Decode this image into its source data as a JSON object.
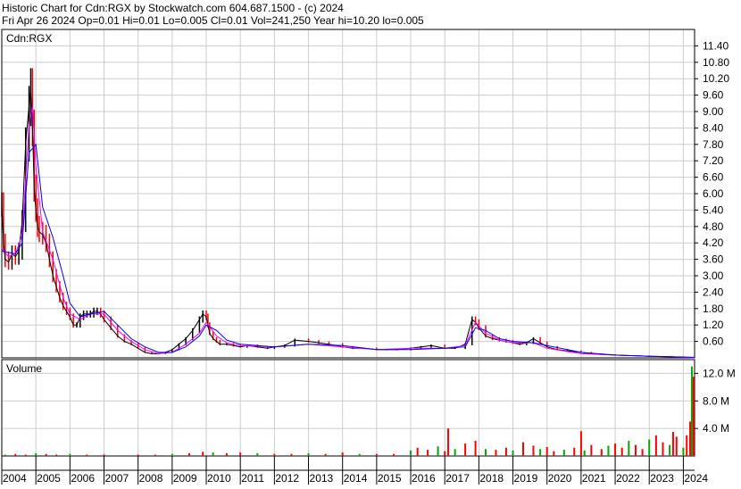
{
  "header": {
    "line1": "Historic Chart for Cdn:RGX by Stockwatch.com 604.687.1500 - (c) 2024",
    "line2": "Fri Apr 26 2024   Op=0.01  Hi=0.01  Lo=0.005  Cl=0.01  Vol=241,250  Year hi=10.20  lo=0.005"
  },
  "price_panel": {
    "symbol_label": "Cdn:RGX"
  },
  "volume_panel": {
    "label": "Volume"
  },
  "colors": {
    "background": "#ffffff",
    "grid": "#cccccc",
    "price_up": "#000000",
    "price_down": "#ff0000",
    "ma_short": "#ff00ff",
    "ma_long": "#0000ff",
    "volume_up": "#00aa00",
    "volume_down": "#ff0000"
  },
  "chart_data": [
    {
      "type": "line",
      "title": "Historic Chart for Cdn:RGX",
      "ylabel": "",
      "xlabel": "",
      "ylim": [
        0,
        12.0
      ],
      "yticks": [
        "11.40",
        "10.80",
        "10.20",
        "9.60",
        "9.00",
        "8.40",
        "7.80",
        "7.20",
        "6.60",
        "6.00",
        "5.40",
        "4.80",
        "4.20",
        "3.60",
        "3.00",
        "2.40",
        "1.80",
        "1.20",
        "0.60"
      ],
      "ytick_values": [
        11.4,
        10.8,
        10.2,
        9.6,
        9.0,
        8.4,
        7.8,
        7.2,
        6.6,
        6.0,
        5.4,
        4.8,
        4.2,
        3.6,
        3.0,
        2.4,
        1.8,
        1.2,
        0.6
      ],
      "xlim": [
        2004.0,
        2024.33
      ],
      "xticks": [
        "2004",
        "2005",
        "2006",
        "2007",
        "2008",
        "2009",
        "2010",
        "2011",
        "2012",
        "2013",
        "2014",
        "2015",
        "2016",
        "2017",
        "2018",
        "2019",
        "2020",
        "2021",
        "2022",
        "2023",
        "2024"
      ],
      "grid": true,
      "series": [
        {
          "kind": "price",
          "x": [
            2004.0,
            2004.05,
            2004.1,
            2004.2,
            2004.3,
            2004.4,
            2004.5,
            2004.6,
            2004.7,
            2004.8,
            2004.85,
            2004.9,
            2004.95,
            2005.0,
            2005.05,
            2005.1,
            2005.2,
            2005.3,
            2005.4,
            2005.5,
            2005.6,
            2005.7,
            2005.8,
            2005.9,
            2006.0,
            2006.1,
            2006.2,
            2006.3,
            2006.4,
            2006.5,
            2006.6,
            2006.7,
            2006.8,
            2006.9,
            2007.0,
            2007.2,
            2007.4,
            2007.6,
            2007.8,
            2008.0,
            2008.2,
            2008.4,
            2008.6,
            2008.8,
            2009.0,
            2009.2,
            2009.4,
            2009.6,
            2009.8,
            2009.9,
            2010.0,
            2010.05,
            2010.1,
            2010.2,
            2010.3,
            2010.4,
            2010.6,
            2010.8,
            2011.0,
            2011.2,
            2011.5,
            2011.8,
            2012.0,
            2012.3,
            2012.6,
            2013.0,
            2013.3,
            2013.6,
            2014.0,
            2014.3,
            2014.6,
            2015.0,
            2015.3,
            2015.6,
            2016.0,
            2016.3,
            2016.6,
            2017.0,
            2017.3,
            2017.6,
            2017.8,
            2017.9,
            2018.0,
            2018.2,
            2018.4,
            2018.6,
            2018.8,
            2019.0,
            2019.2,
            2019.4,
            2019.6,
            2019.8,
            2020.0,
            2020.3,
            2020.6,
            2021.0,
            2021.3,
            2021.6,
            2022.0,
            2022.3,
            2022.6,
            2023.0,
            2023.3,
            2023.6,
            2024.0,
            2024.33
          ],
          "values": [
            5.6,
            4.2,
            3.6,
            3.5,
            3.8,
            3.7,
            3.9,
            5.0,
            7.8,
            9.2,
            9.8,
            8.4,
            6.2,
            5.4,
            4.8,
            4.6,
            4.5,
            4.2,
            3.6,
            3.0,
            2.6,
            2.2,
            1.9,
            1.7,
            1.5,
            1.2,
            1.2,
            1.5,
            1.6,
            1.6,
            1.6,
            1.7,
            1.7,
            1.6,
            1.4,
            1.1,
            0.8,
            0.6,
            0.5,
            0.35,
            0.2,
            0.15,
            0.15,
            0.2,
            0.3,
            0.5,
            0.7,
            1.0,
            1.4,
            1.6,
            1.5,
            1.2,
            0.9,
            0.7,
            0.6,
            0.5,
            0.5,
            0.45,
            0.4,
            0.45,
            0.4,
            0.35,
            0.4,
            0.45,
            0.65,
            0.6,
            0.55,
            0.5,
            0.4,
            0.35,
            0.35,
            0.3,
            0.3,
            0.3,
            0.35,
            0.4,
            0.45,
            0.35,
            0.35,
            0.5,
            1.4,
            1.3,
            1.1,
            0.8,
            0.7,
            0.65,
            0.6,
            0.55,
            0.5,
            0.55,
            0.7,
            0.55,
            0.4,
            0.3,
            0.25,
            0.2,
            0.15,
            0.12,
            0.1,
            0.08,
            0.08,
            0.06,
            0.05,
            0.04,
            0.02,
            0.01
          ]
        },
        {
          "kind": "moving-average-short",
          "x": [
            2004.0,
            2004.2,
            2004.4,
            2004.6,
            2004.8,
            2004.9,
            2005.0,
            2005.2,
            2005.5,
            2005.8,
            2006.0,
            2006.3,
            2006.6,
            2007.0,
            2007.4,
            2007.8,
            2008.2,
            2008.6,
            2009.0,
            2009.4,
            2009.8,
            2010.0,
            2010.3,
            2010.6,
            2011.0,
            2012.0,
            2013.0,
            2014.0,
            2015.0,
            2016.0,
            2017.0,
            2017.6,
            2017.9,
            2018.2,
            2018.6,
            2019.0,
            2019.6,
            2020.0,
            2021.0,
            2022.0,
            2023.0,
            2024.33
          ],
          "values": [
            4.0,
            3.7,
            3.8,
            4.5,
            8.5,
            9.2,
            7.0,
            4.6,
            3.6,
            2.2,
            1.6,
            1.4,
            1.6,
            1.6,
            1.0,
            0.6,
            0.3,
            0.15,
            0.2,
            0.5,
            0.9,
            1.3,
            0.8,
            0.55,
            0.45,
            0.4,
            0.5,
            0.4,
            0.3,
            0.35,
            0.35,
            0.45,
            1.3,
            0.9,
            0.65,
            0.55,
            0.55,
            0.35,
            0.15,
            0.1,
            0.06,
            0.01
          ]
        },
        {
          "kind": "moving-average-long",
          "x": [
            2004.0,
            2004.4,
            2004.6,
            2004.8,
            2005.0,
            2005.2,
            2005.5,
            2005.8,
            2006.0,
            2006.3,
            2006.6,
            2007.0,
            2007.4,
            2007.8,
            2008.2,
            2008.6,
            2009.0,
            2009.4,
            2009.8,
            2010.0,
            2010.3,
            2010.6,
            2011.0,
            2012.0,
            2013.0,
            2014.0,
            2015.0,
            2016.0,
            2017.0,
            2017.6,
            2017.9,
            2018.2,
            2018.6,
            2019.0,
            2019.6,
            2020.0,
            2021.0,
            2022.0,
            2023.0,
            2024.33
          ],
          "values": [
            3.9,
            3.8,
            4.2,
            7.5,
            7.8,
            5.5,
            4.4,
            3.0,
            2.0,
            1.5,
            1.6,
            1.7,
            1.2,
            0.7,
            0.4,
            0.2,
            0.2,
            0.4,
            0.8,
            1.2,
            1.0,
            0.65,
            0.5,
            0.4,
            0.5,
            0.45,
            0.3,
            0.3,
            0.35,
            0.4,
            1.1,
            1.0,
            0.7,
            0.6,
            0.55,
            0.45,
            0.2,
            0.1,
            0.06,
            0.02
          ]
        }
      ]
    },
    {
      "type": "bar",
      "title": "Volume",
      "ylim": [
        0,
        14.0
      ],
      "yticks": [
        "12.0 M",
        "8.0 M",
        "4.0 M"
      ],
      "ytick_values": [
        12.0,
        8.0,
        4.0
      ],
      "unit": "M",
      "series": [
        {
          "name": "Volume",
          "x": [
            2004.1,
            2004.4,
            2004.7,
            2005.0,
            2005.3,
            2005.6,
            2006.0,
            2006.5,
            2007.0,
            2007.5,
            2008.0,
            2008.5,
            2009.0,
            2009.5,
            2009.9,
            2010.2,
            2010.6,
            2011.0,
            2011.5,
            2012.0,
            2012.5,
            2013.0,
            2013.5,
            2014.0,
            2014.5,
            2015.0,
            2015.5,
            2016.0,
            2016.2,
            2016.5,
            2016.8,
            2017.0,
            2017.1,
            2017.3,
            2017.6,
            2017.9,
            2018.2,
            2018.5,
            2018.8,
            2019.0,
            2019.3,
            2019.6,
            2019.8,
            2020.0,
            2020.2,
            2020.5,
            2020.8,
            2021.0,
            2021.1,
            2021.3,
            2021.6,
            2021.8,
            2022.0,
            2022.2,
            2022.4,
            2022.6,
            2022.8,
            2023.0,
            2023.2,
            2023.4,
            2023.6,
            2023.7,
            2023.8,
            2024.0,
            2024.1,
            2024.2,
            2024.25,
            2024.3
          ],
          "values": [
            0.2,
            0.3,
            0.2,
            0.4,
            0.3,
            0.2,
            0.3,
            0.2,
            0.2,
            0.1,
            0.2,
            0.2,
            0.3,
            0.4,
            0.6,
            0.5,
            0.4,
            0.5,
            0.4,
            0.3,
            0.3,
            0.4,
            0.3,
            0.5,
            0.3,
            0.3,
            0.3,
            0.8,
            1.2,
            0.9,
            1.4,
            0.7,
            4.0,
            1.0,
            1.8,
            2.2,
            1.0,
            0.9,
            1.2,
            0.8,
            2.0,
            1.5,
            1.0,
            1.3,
            0.7,
            0.9,
            1.2,
            3.6,
            0.8,
            1.6,
            1.0,
            1.5,
            1.8,
            1.2,
            2.2,
            1.6,
            1.0,
            2.4,
            3.0,
            2.0,
            1.6,
            3.5,
            2.8,
            1.2,
            3.0,
            5.0,
            13.0,
            11.5
          ]
        }
      ]
    }
  ]
}
